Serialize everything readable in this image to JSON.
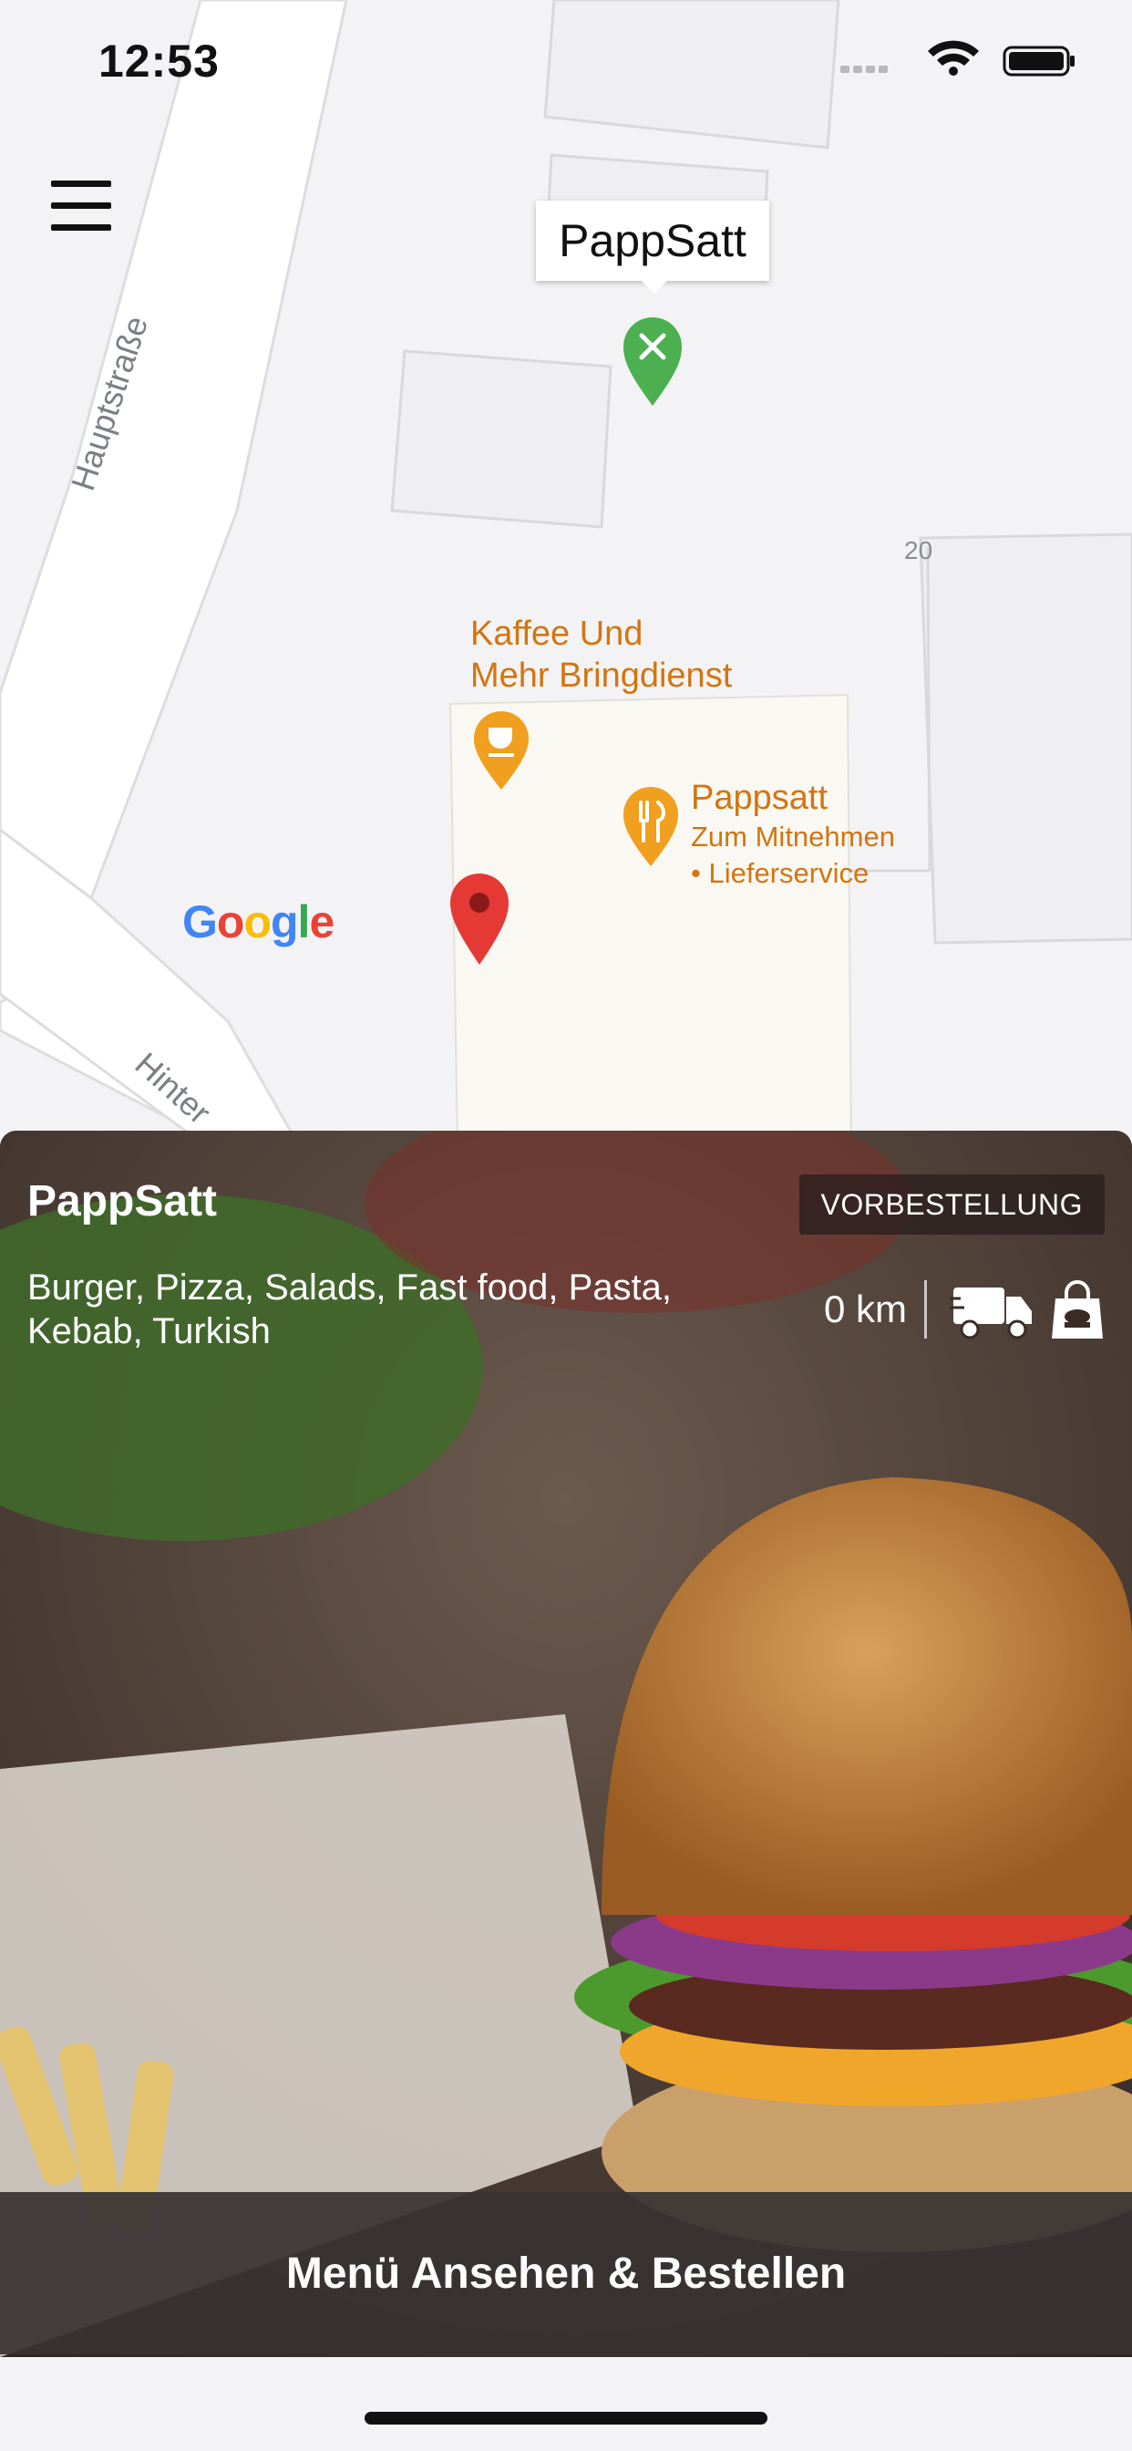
{
  "status_bar": {
    "time": "12:53",
    "icons": [
      "signal-icon",
      "wifi-icon",
      "battery-icon"
    ]
  },
  "map": {
    "callout": "PappSatt",
    "road_labels": [
      "Hauptstraße",
      "Hinter"
    ],
    "house_number": "20",
    "pois": [
      {
        "name_line1": "Kaffee Und",
        "name_line2": "Mehr Bringdienst",
        "icon": "cup-icon"
      },
      {
        "name": "Pappsatt",
        "sub1": "Zum Mitnehmen",
        "sub2": "• Lieferservice",
        "icon": "utensils-icon"
      }
    ],
    "google_logo": "Google"
  },
  "restaurant": {
    "name": "PappSatt",
    "badge": "VORBESTELLUNG",
    "cuisines": "Burger, Pizza, Salads, Fast food, Pasta, Kebab, Turkish",
    "distance": "0 km",
    "services": [
      "truck-icon",
      "shopping-bag-icon"
    ]
  },
  "cta": {
    "label": "Menü Ansehen & Bestellen"
  },
  "colors": {
    "poi_orange": "#d37510",
    "marker_green": "#4cb050",
    "marker_red": "#e53935"
  }
}
